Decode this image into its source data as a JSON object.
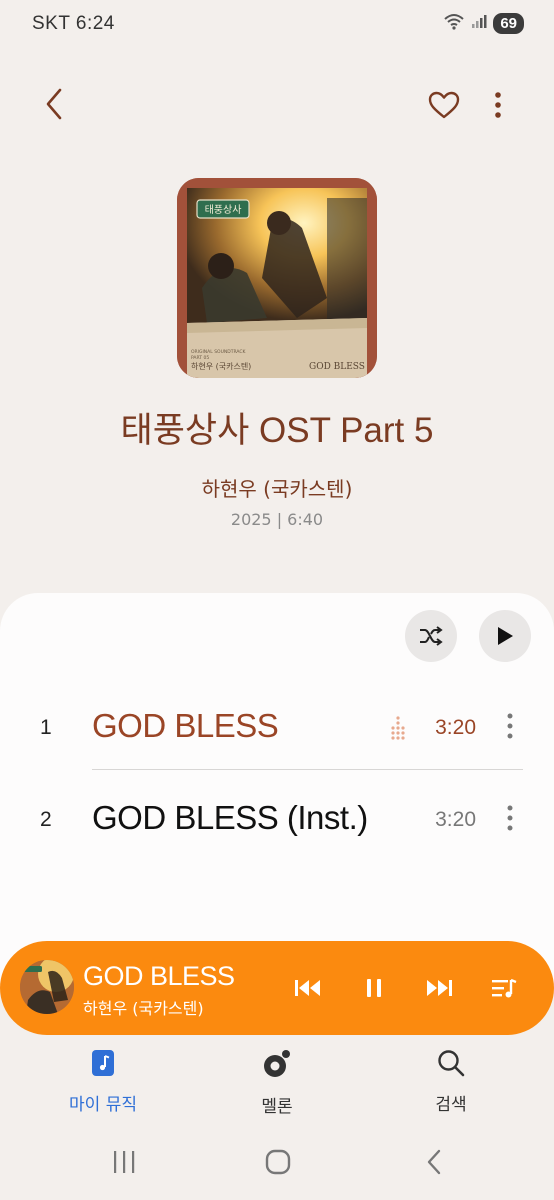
{
  "status": {
    "carrier_time": "SKT 6:24",
    "battery": "69"
  },
  "album": {
    "title": "태풍상사 OST Part 5",
    "artist": "하현우 (국카스텐)",
    "meta": "2025 | 6:40",
    "cover_logo": "태풍상사",
    "cover_song": "GOD BLESS",
    "cover_artist": "하현우 (국카스텐)",
    "cover_ost": "ORIGINAL SOUNDTRACK",
    "cover_part": "PART 05"
  },
  "tracks": [
    {
      "num": "1",
      "title": "GOD BLESS",
      "duration": "3:20",
      "playing": true
    },
    {
      "num": "2",
      "title": "GOD BLESS (Inst.)",
      "duration": "3:20",
      "playing": false
    }
  ],
  "mini_player": {
    "title": "GOD BLESS",
    "artist": "하현우 (국카스텐)"
  },
  "nav": {
    "my_music": "마이 뮤직",
    "melon": "멜론",
    "search": "검색"
  },
  "colors": {
    "accent_brown": "#7a3b22",
    "player_orange": "#fb8a0f",
    "active_nav": "#2f6fd6"
  }
}
